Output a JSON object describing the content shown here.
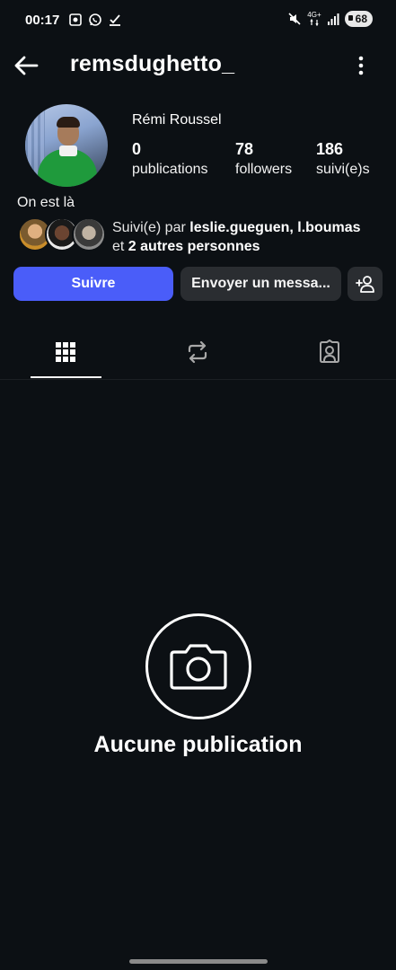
{
  "status_bar": {
    "time": "00:17",
    "network_label": "4G+",
    "battery_level": "68",
    "icons_left": [
      "screen-record-icon",
      "whatsapp-icon",
      "download-check-icon"
    ],
    "icons_right": [
      "mute-icon",
      "network-icon",
      "signal-icon",
      "battery-icon"
    ]
  },
  "header": {
    "username": "remsdughetto_",
    "back_icon": "arrow-left-icon",
    "menu_icon": "more-vertical-icon"
  },
  "profile": {
    "full_name": "Rémi Roussel",
    "stats": [
      {
        "value": "0",
        "label": "publications"
      },
      {
        "value": "78",
        "label": "followers"
      },
      {
        "value": "186",
        "label": "suivi(e)s"
      }
    ],
    "bio": "On est là",
    "followed_by": {
      "prefix": "Suivi(e) par ",
      "names": "leslie.gueguen, l.boumas",
      "connector": "et ",
      "others": "2 autres personnes"
    }
  },
  "actions": {
    "follow_label": "Suivre",
    "message_label": "Envoyer un messa...",
    "add_user_icon": "add-user-icon"
  },
  "tabs": [
    {
      "name": "grid",
      "icon": "grid-icon",
      "active": true
    },
    {
      "name": "reels",
      "icon": "repost-icon",
      "active": false
    },
    {
      "name": "tagged",
      "icon": "tagged-user-icon",
      "active": false
    }
  ],
  "empty_state": {
    "icon": "camera-icon",
    "text": "Aucune publication"
  },
  "colors": {
    "background": "#0c1014",
    "accent": "#4a5df9",
    "secondary_button": "#2a2d31"
  }
}
